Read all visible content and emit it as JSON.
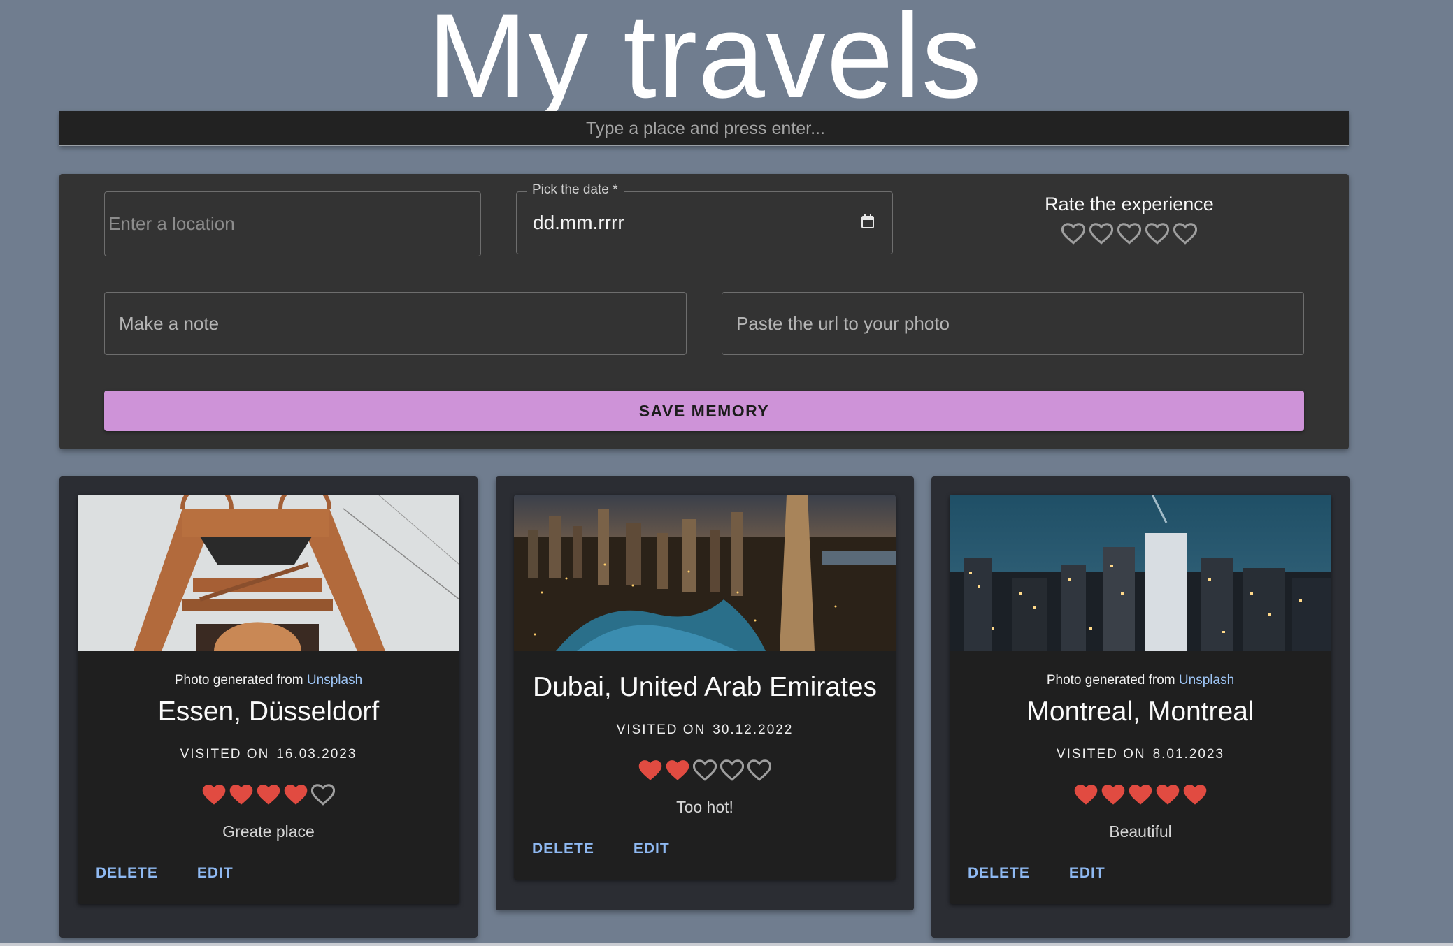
{
  "title": "My travels",
  "search": {
    "placeholder": "Type a place and press enter..."
  },
  "form": {
    "location_placeholder": "Enter a location",
    "date_label": "Pick the date *",
    "date_value": "dd.mm.rrrr",
    "rate_label": "Rate the experience",
    "rating": 0,
    "rating_max": 5,
    "note_placeholder": "Make a note",
    "url_placeholder": "Paste the url to your photo",
    "save_label": "SAVE MEMORY"
  },
  "colors": {
    "background": "#707d8f",
    "panel": "#333333",
    "card": "#1f1f1f",
    "accent": "#ce93d8",
    "heart": "#e14b41",
    "link": "#8fb9f2"
  },
  "cards": [
    {
      "credit_text": "Photo generated from",
      "credit_link": "Unsplash",
      "title": "Essen, Düsseldorf",
      "visited_label": "VISITED ON",
      "visited_date": "16.03.2023",
      "rating": 4,
      "rating_max": 5,
      "note": "Greate place",
      "delete_label": "DELETE",
      "edit_label": "EDIT",
      "photo": "industrial-tower"
    },
    {
      "credit_text": "",
      "credit_link": "",
      "title": "Dubai, United Arab Emirates",
      "visited_label": "VISITED ON",
      "visited_date": "30.12.2022",
      "rating": 2,
      "rating_max": 5,
      "note": "Too hot!",
      "delete_label": "DELETE",
      "edit_label": "EDIT",
      "photo": "city-night-marina"
    },
    {
      "credit_text": "Photo generated from",
      "credit_link": "Unsplash",
      "title": "Montreal, Montreal",
      "visited_label": "VISITED ON",
      "visited_date": "8.01.2023",
      "rating": 5,
      "rating_max": 5,
      "note": "Beautiful",
      "delete_label": "DELETE",
      "edit_label": "EDIT",
      "photo": "city-skyline-dusk"
    }
  ]
}
